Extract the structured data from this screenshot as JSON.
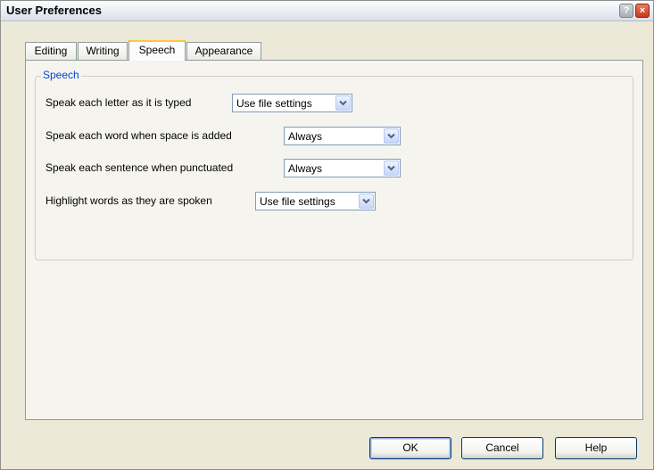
{
  "window": {
    "title": "User Preferences",
    "help_glyph": "?",
    "close_glyph": "×"
  },
  "tabs": [
    {
      "label": "Editing",
      "active": false
    },
    {
      "label": "Writing",
      "active": false
    },
    {
      "label": "Speech",
      "active": true
    },
    {
      "label": "Appearance",
      "active": false
    }
  ],
  "speech_group": {
    "title": "Speech",
    "rows": [
      {
        "label": "Speak each letter as it is typed",
        "value": "Use file settings"
      },
      {
        "label": "Speak each word when space is added",
        "value": "Always"
      },
      {
        "label": "Speak each sentence when punctuated",
        "value": "Always"
      },
      {
        "label": "Highlight words as they are spoken",
        "value": "Use file settings"
      }
    ]
  },
  "buttons": {
    "ok": "OK",
    "cancel": "Cancel",
    "help": "Help"
  },
  "colors": {
    "group_title": "#0046d5",
    "active_tab_accent": "#ffc83c",
    "close_button": "#c8371a"
  }
}
